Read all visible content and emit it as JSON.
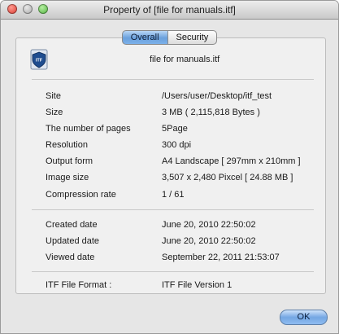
{
  "window": {
    "title": "Property of [file for manuals.itf]"
  },
  "tabs": [
    {
      "label": "Overall",
      "active": true
    },
    {
      "label": "Security",
      "active": false
    }
  ],
  "file": {
    "icon": "itf-document-icon",
    "icon_text": "ITF",
    "name": "file for manuals.itf"
  },
  "details": [
    {
      "label": "Site",
      "value": "/Users/user/Desktop/itf_test"
    },
    {
      "label": "Size",
      "value": "3 MB ( 2,115,818 Bytes )"
    },
    {
      "label": "The number of pages",
      "value": "5Page"
    },
    {
      "label": "Resolution",
      "value": "300 dpi"
    },
    {
      "label": "Output form",
      "value": "A4 Landscape [ 297mm x 210mm ]"
    },
    {
      "label": "Image size",
      "value": "3,507 x 2,480 Pixcel  [ 24.88 MB ]"
    },
    {
      "label": "Compression rate",
      "value": "1 / 61"
    }
  ],
  "dates": [
    {
      "label": "Created date",
      "value": "June 20, 2010 22:50:02"
    },
    {
      "label": "Updated date",
      "value": "June 20, 2010 22:50:02"
    },
    {
      "label": "Viewed date",
      "value": "September 22, 2011 21:53:07"
    }
  ],
  "format": {
    "label": "ITF File Format :",
    "value": "ITF File Version 1"
  },
  "buttons": {
    "ok": "OK"
  },
  "colors": {
    "accent": "#6aa0dc",
    "shield": "#1f4d8f"
  }
}
